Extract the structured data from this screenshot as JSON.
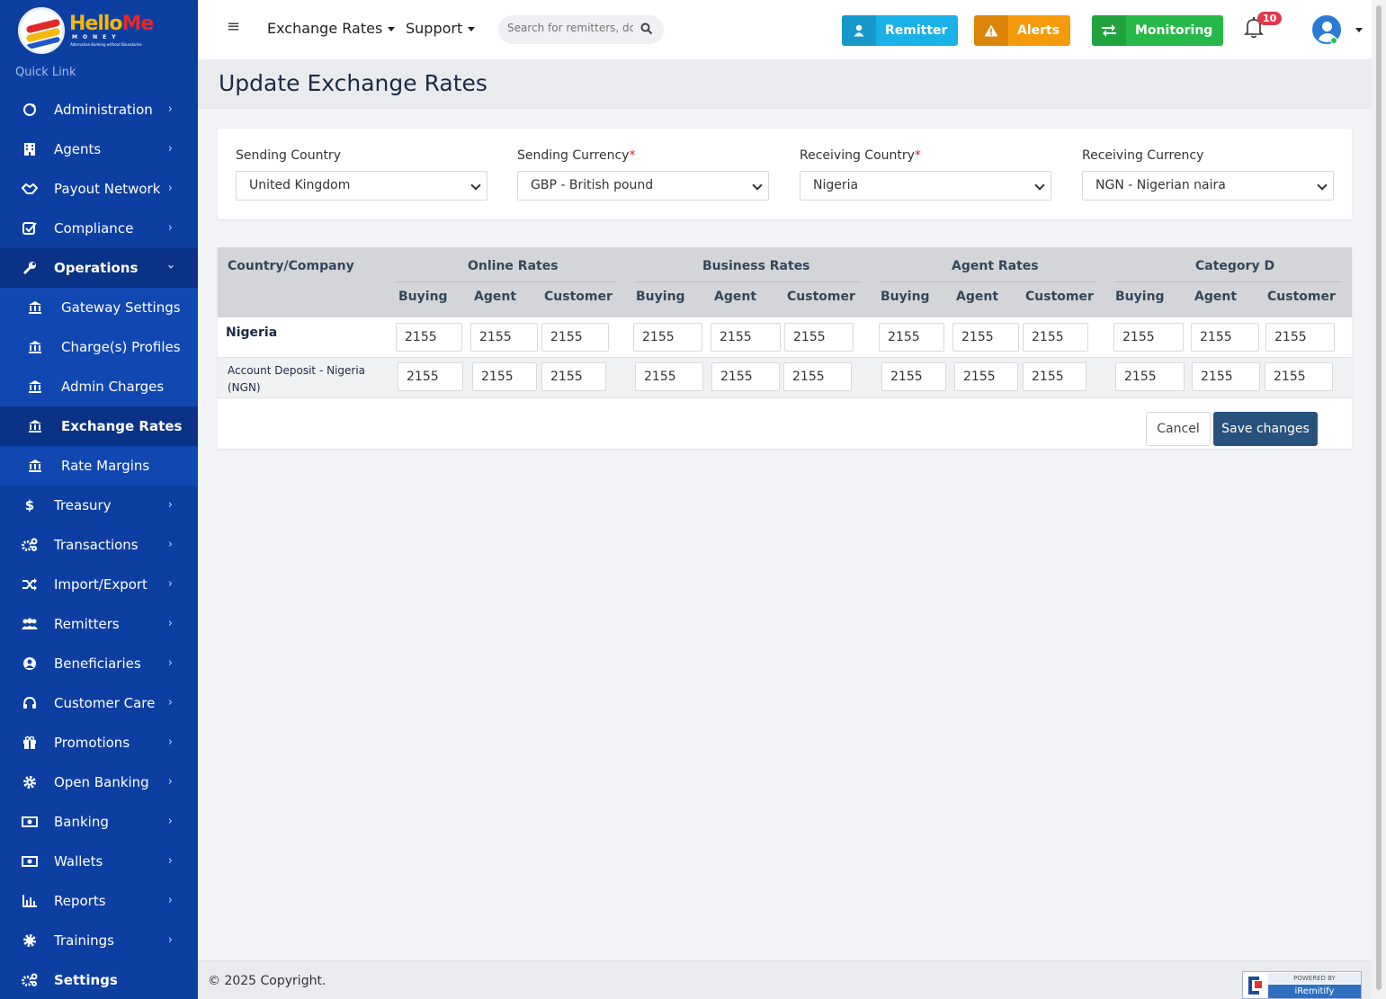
{
  "brand": {
    "logo_main": "Hello",
    "logo_accent": "Me",
    "logo_sub": "MONEY",
    "logo_tagline": "Alternative Banking without Boundaries"
  },
  "sidebar": {
    "quick_link": "Quick Link",
    "items": [
      {
        "label": "Administration",
        "icon": "cycle-icon"
      },
      {
        "label": "Agents",
        "icon": "building-icon"
      },
      {
        "label": "Payout Network",
        "icon": "handshake-icon"
      },
      {
        "label": "Compliance",
        "icon": "check-square-icon"
      },
      {
        "label": "Operations",
        "icon": "wrench-icon"
      },
      {
        "label": "Gateway Settings",
        "icon": "bank-icon"
      },
      {
        "label": "Charge(s) Profiles",
        "icon": "bank-icon"
      },
      {
        "label": "Admin Charges",
        "icon": "bank-icon"
      },
      {
        "label": "Exchange Rates",
        "icon": "bank-icon"
      },
      {
        "label": "Rate Margins",
        "icon": "bank-icon"
      },
      {
        "label": "Treasury",
        "icon": "dollar-icon"
      },
      {
        "label": "Transactions",
        "icon": "cogs-icon"
      },
      {
        "label": "Import/Export",
        "icon": "shuffle-icon"
      },
      {
        "label": "Remitters",
        "icon": "users-icon"
      },
      {
        "label": "Beneficiaries",
        "icon": "user-circle-icon"
      },
      {
        "label": "Customer Care",
        "icon": "headset-icon"
      },
      {
        "label": "Promotions",
        "icon": "gift-icon"
      },
      {
        "label": "Open Banking",
        "icon": "gear-icon"
      },
      {
        "label": "Banking",
        "icon": "money-icon"
      },
      {
        "label": "Wallets",
        "icon": "money-icon"
      },
      {
        "label": "Reports",
        "icon": "bar-chart-icon"
      },
      {
        "label": "Trainings",
        "icon": "gear-icon"
      },
      {
        "label": "Settings",
        "icon": "cogs-icon"
      }
    ]
  },
  "topbar": {
    "menu_exchange_rates": "Exchange Rates",
    "menu_support": "Support",
    "search_placeholder": "Search for remitters, dc",
    "btn_remitter": "Remitter",
    "btn_alerts": "Alerts",
    "btn_monitoring": "Monitoring",
    "notification_count": "10",
    "colors": {
      "remitter": "#1ab0e8",
      "alerts": "#f59a0a",
      "monitoring": "#27b84a"
    }
  },
  "page": {
    "title": "Update Exchange Rates"
  },
  "filters": {
    "sending_country": {
      "label": "Sending Country",
      "value": "United Kingdom",
      "required": false
    },
    "sending_currency": {
      "label": "Sending Currency",
      "value": "GBP - British pound",
      "required": true
    },
    "receiving_country": {
      "label": "Receiving Country",
      "value": "Nigeria",
      "required": true
    },
    "receiving_currency": {
      "label": "Receiving Currency",
      "value": "NGN - Nigerian naira",
      "required": false
    }
  },
  "rates_table": {
    "first_column": "Country/Company",
    "groups": [
      "Online Rates",
      "Business Rates",
      "Agent Rates",
      "Category D"
    ],
    "sub_columns": [
      "Buying",
      "Agent",
      "Customer"
    ],
    "rows": [
      {
        "label": "Nigeria",
        "values": [
          "2155",
          "2155",
          "2155",
          "2155",
          "2155",
          "2155",
          "2155",
          "2155",
          "2155",
          "2155",
          "2155",
          "2155"
        ]
      },
      {
        "label_line1": "Account Deposit - Nigeria",
        "label_line2": "(NGN)",
        "values": [
          "2155",
          "2155",
          "2155",
          "2155",
          "2155",
          "2155",
          "2155",
          "2155",
          "2155",
          "2155",
          "2155",
          "2155"
        ]
      }
    ]
  },
  "actions": {
    "cancel": "Cancel",
    "save": "Save changes"
  },
  "footer": {
    "copyright": "© 2025 Copyright.",
    "powered_by": "POWERED BY",
    "powered_brand": "iRemitify"
  }
}
